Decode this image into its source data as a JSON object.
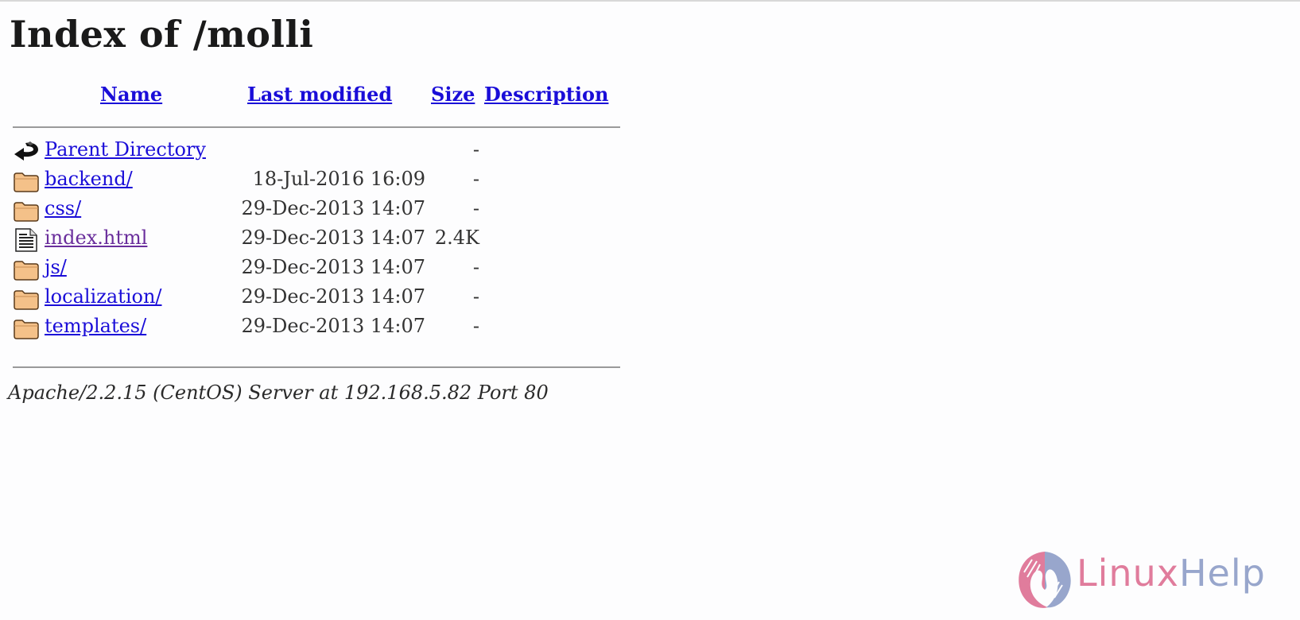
{
  "page": {
    "title": "Index of /molli"
  },
  "table": {
    "headers": {
      "name": "Name",
      "last_modified": "Last modified",
      "size": "Size",
      "description": "Description"
    },
    "rows": [
      {
        "icon": "parent-directory-icon",
        "name": "Parent Directory",
        "date": "",
        "size": "-",
        "visited": false
      },
      {
        "icon": "folder-icon",
        "name": "backend/",
        "date": "18-Jul-2016 16:09",
        "size": "-",
        "visited": false
      },
      {
        "icon": "folder-icon",
        "name": "css/",
        "date": "29-Dec-2013 14:07",
        "size": "-",
        "visited": false
      },
      {
        "icon": "text-file-icon",
        "name": "index.html",
        "date": "29-Dec-2013 14:07",
        "size": "2.4K",
        "visited": true
      },
      {
        "icon": "folder-icon",
        "name": "js/",
        "date": "29-Dec-2013 14:07",
        "size": "-",
        "visited": false
      },
      {
        "icon": "folder-icon",
        "name": "localization/",
        "date": "29-Dec-2013 14:07",
        "size": "-",
        "visited": false
      },
      {
        "icon": "folder-icon",
        "name": "templates/",
        "date": "29-Dec-2013 14:07",
        "size": "-",
        "visited": false
      }
    ]
  },
  "footer": {
    "signature": "Apache/2.2.15 (CentOS) Server at 192.168.5.82 Port 80"
  },
  "watermark": {
    "part1": "Linux",
    "part2": "Help",
    "colors": {
      "pink": "#e07c9c",
      "blue": "#98a6cc"
    }
  },
  "colors": {
    "link": "#1a0dd8",
    "visited_link": "#6a2e9c",
    "folder": "#f4c189"
  }
}
